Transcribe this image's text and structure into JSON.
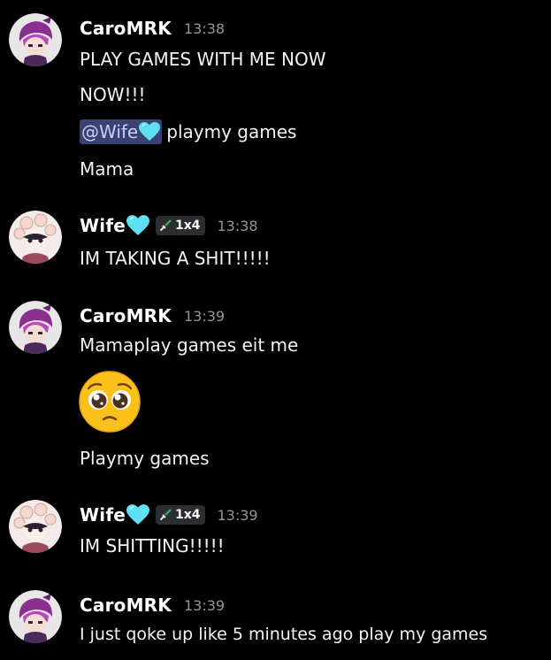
{
  "messages": [
    {
      "author": "CaroMRK",
      "time": "13:38",
      "lines": [
        "PLAY GAMES WITH ME NOW",
        "NOW!!!",
        "playmy games",
        "Mama"
      ],
      "mention": "@Wife"
    },
    {
      "author": "Wife",
      "tag": "1x4",
      "time": "13:38",
      "lines": [
        "IM TAKING A SHIT!!!!!"
      ]
    },
    {
      "author": "CaroMRK",
      "time": "13:39",
      "lines": [
        "Mamaplay games eit me",
        "Playmy games"
      ],
      "emoji": "pleading-face"
    },
    {
      "author": "Wife",
      "tag": "1x4",
      "time": "13:39",
      "lines": [
        "IM SHITTING!!!!!"
      ]
    },
    {
      "author": "CaroMRK",
      "time": "13:39",
      "lines": [
        "I just qoke up like 5 minutes ago play my games"
      ]
    }
  ],
  "colors": {
    "background": "#000000",
    "timestamp": "#94959c",
    "mention_bg": "#3c4270",
    "mention_text": "#c9cdfb",
    "heart": "#5ee0f2",
    "tag_bg": "#2b2d31"
  },
  "icons": {
    "heart": "light-blue-heart-icon",
    "tag": "sword-icon",
    "emoji": "pleading-face-emoji"
  }
}
